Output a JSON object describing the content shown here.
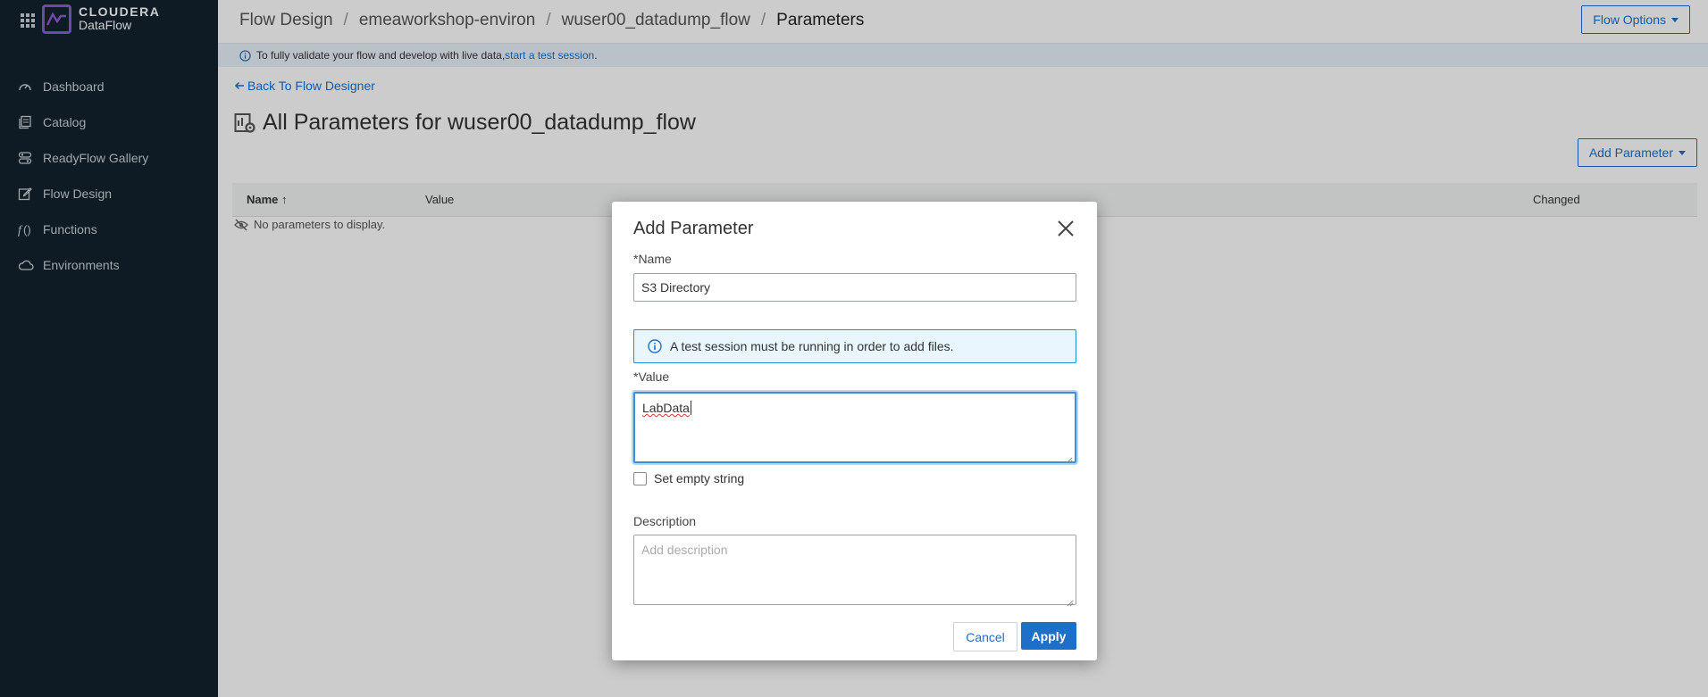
{
  "sidebar": {
    "brand_top": "CLOUDERA",
    "brand_bottom": "DataFlow",
    "items": [
      {
        "label": "Dashboard",
        "icon": "gauge-icon"
      },
      {
        "label": "Catalog",
        "icon": "catalog-icon"
      },
      {
        "label": "ReadyFlow Gallery",
        "icon": "readyflow-icon"
      },
      {
        "label": "Flow Design",
        "icon": "edit-icon"
      },
      {
        "label": "Functions",
        "icon": "function-icon"
      },
      {
        "label": "Environments",
        "icon": "cloud-icon"
      }
    ]
  },
  "header": {
    "breadcrumbs": [
      "Flow Design",
      "emeaworkshop-environ",
      "wuser00_datadump_flow",
      "Parameters"
    ],
    "flow_options_label": "Flow Options"
  },
  "banner": {
    "text": "To fully validate your flow and develop with live data, ",
    "link": "start a test session",
    "suffix": "."
  },
  "page": {
    "back_label": "Back To Flow Designer",
    "title": "All Parameters for wuser00_datadump_flow",
    "add_parameter_label": "Add Parameter",
    "columns": [
      "Name",
      "Value",
      "Changed"
    ],
    "empty_text": "No parameters to display."
  },
  "modal": {
    "title": "Add Parameter",
    "name_label": "*Name",
    "name_value": "S3 Directory",
    "info_text": "A test session must be running in order to add files.",
    "value_label": "*Value",
    "value_value": "LabData",
    "set_empty_label": "Set empty string",
    "description_label": "Description",
    "description_placeholder": "Add description",
    "cancel_label": "Cancel",
    "apply_label": "Apply"
  },
  "colors": {
    "sidebar_bg": "#13222d",
    "accent": "#1e6fc8",
    "logo": "#8a5cd6",
    "info_border": "#1e90d6"
  }
}
